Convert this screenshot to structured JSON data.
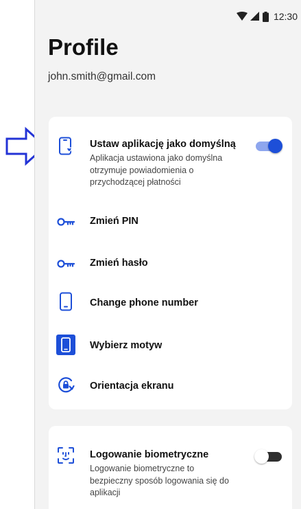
{
  "status_bar": {
    "time": "12:30",
    "icons": [
      "wifi-icon",
      "signal-icon",
      "battery-icon"
    ]
  },
  "page": {
    "title": "Profile",
    "email": "john.smith@gmail.com"
  },
  "settings_card": {
    "items": [
      {
        "icon": "phone-heart-icon",
        "label": "Ustaw aplikację jako domyślną",
        "description": "Aplikacja ustawiona jako domyślna otrzymuje powiadomienia o przychodzącej płatności",
        "toggle": "on"
      },
      {
        "icon": "key-icon",
        "label": "Zmień PIN"
      },
      {
        "icon": "key-icon",
        "label": "Zmień hasło"
      },
      {
        "icon": "phone-icon",
        "label": "Change phone number"
      },
      {
        "icon": "theme-phone-icon",
        "label": "Wybierz motyw"
      },
      {
        "icon": "screen-rotation-lock-icon",
        "label": "Orientacja ekranu"
      }
    ]
  },
  "biometric_card": {
    "icon": "face-id-icon",
    "label": "Logowanie biometryczne",
    "description": "Logowanie biometryczne to bezpieczny sposób logowania się do aplikacji",
    "toggle": "off"
  },
  "annotation": {
    "icon": "arrow-right-icon"
  },
  "colors": {
    "accent": "#1d4fd8",
    "accent_track": "#8ea6ee",
    "toggle_off_knob": "#ffffff",
    "toggle_off_track": "#2f2f2f",
    "background": "#f3f3f3",
    "card": "#ffffff",
    "arrow_outline": "#2333d6"
  }
}
